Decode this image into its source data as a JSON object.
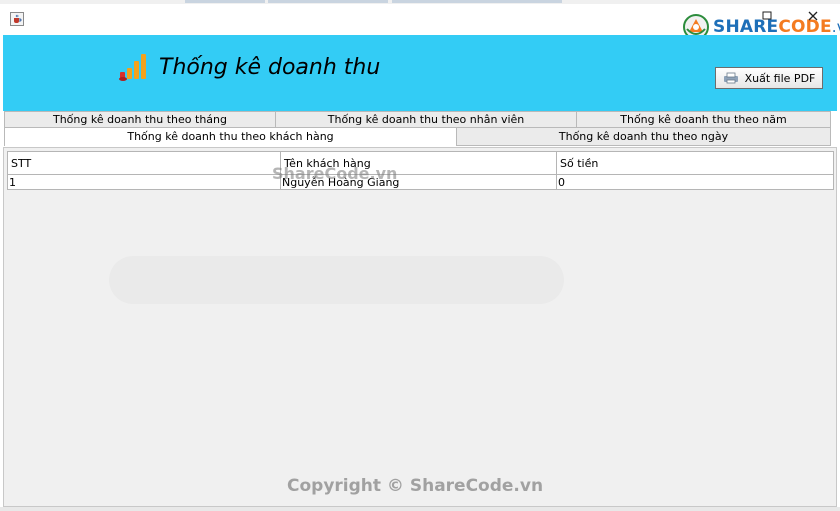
{
  "window": {
    "app_icon": "java-cup-icon",
    "brand": {
      "part1": "SHARE",
      "part2": "CODE",
      "part3": ".vn"
    }
  },
  "header": {
    "title": "Thống kê doanh thu",
    "title_icon": "bar-chart-icon",
    "export_button": {
      "label": "Xuất file PDF",
      "icon": "printer-icon"
    }
  },
  "tabs": {
    "row1": [
      {
        "label": "Thống kê doanh thu theo tháng"
      },
      {
        "label": "Thống kê doanh thu theo nhân viên"
      },
      {
        "label": "Thống kê doanh thu theo năm"
      }
    ],
    "row2": [
      {
        "label": "Thống kê doanh thu theo khách hàng",
        "active": true
      },
      {
        "label": "Thống kê doanh thu theo ngày"
      }
    ]
  },
  "table": {
    "columns": [
      "STT",
      "Tên khách hàng",
      "Số tiền"
    ],
    "rows": [
      [
        "1",
        "Nguyễn Hoàng Giang",
        "0"
      ]
    ]
  },
  "watermarks": {
    "center": "ShareCode.vn",
    "bottom": "Copyright © ShareCode.vn"
  },
  "colors": {
    "header_bg": "#33ccf5",
    "content_bg": "#f0f0f0",
    "brand_blue": "#1e6fb8",
    "brand_orange": "#f47b20"
  }
}
